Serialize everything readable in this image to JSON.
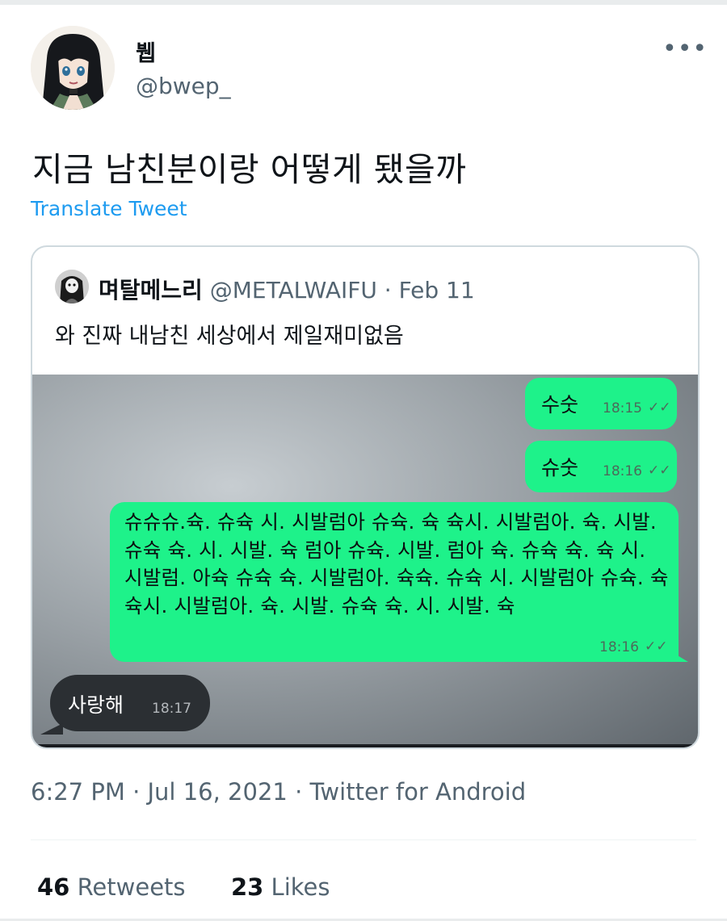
{
  "tweet": {
    "author": {
      "display_name": "뷉",
      "handle": "@bwep_",
      "avatar_icon": "anime-girl-avatar-icon"
    },
    "more_icon": "more-options-icon",
    "more_label": "•••",
    "text": "지금 남친분이랑 어떻게 됐을까",
    "translate_label": "Translate Tweet",
    "meta_line": "6:27 PM · Jul 16, 2021 · Twitter for Android",
    "stats": {
      "retweets_count": "46",
      "retweets_label": "Retweets",
      "likes_count": "23",
      "likes_label": "Likes"
    }
  },
  "quoted_tweet": {
    "author_name": "며탈메느리",
    "author_handle": "@METALWAIFU",
    "separator": "·",
    "date": "Feb 11",
    "text": "와 진짜 내남친 세상에서 제일재미없음",
    "avatar_icon": "gothic-avatar-icon",
    "media": {
      "messages": [
        {
          "text": "수숫",
          "time": "18:15",
          "read_icon": "double-check-icon",
          "sender": "me"
        },
        {
          "text": "슈숫",
          "time": "18:16",
          "read_icon": "double-check-icon",
          "sender": "me"
        },
        {
          "text": "슈슈슈.슉. 슈슉 시. 시발럼아 슈슉. 슉 슉시. 시발럼아. 슉. 시발. 슈슉 슉. 시. 시발. 슉 럼아 슈슉. 시발. 럼아 슉. 슈슉 슉. 슉 시. 시발럼. 아슉 슈슉 슉. 시발럼아. 슉슉. 슈슉 시. 시발럼아 슈슉. 슉 슉시. 시발럼아. 슉. 시발. 슈슉 슉. 시. 시발. 슉",
          "time": "18:16",
          "read_icon": "double-check-icon",
          "sender": "me"
        },
        {
          "text": "사랑해",
          "time": "18:17",
          "sender": "other"
        }
      ]
    }
  },
  "colors": {
    "link": "#1d9bf0",
    "muted": "#536471",
    "sent_bubble": "#1ef28a",
    "received_bubble": "#2b2f33"
  }
}
